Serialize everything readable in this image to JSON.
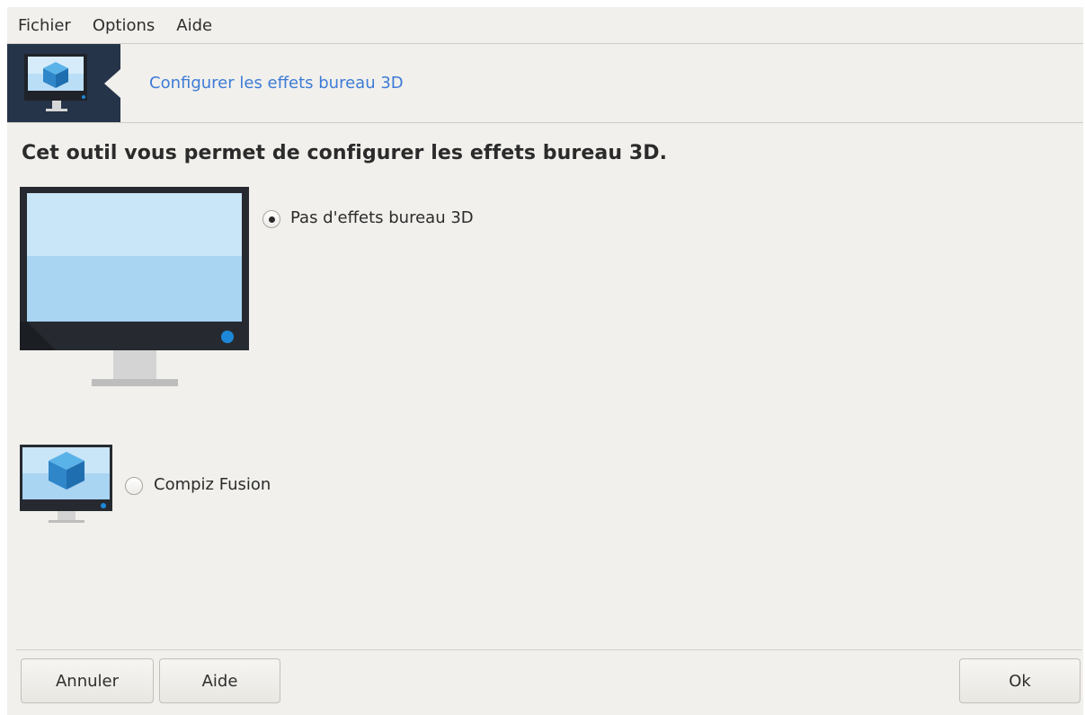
{
  "menubar": {
    "items": [
      "Fichier",
      "Options",
      "Aide"
    ]
  },
  "header": {
    "title": "Configurer les effets bureau 3D",
    "icon": "monitor-cube-icon"
  },
  "intro": "Cet outil vous permet de configurer les effets bureau 3D.",
  "options": [
    {
      "label": "Pas d'effets bureau 3D",
      "selected": true,
      "icon": "monitor-icon"
    },
    {
      "label": "Compiz Fusion",
      "selected": false,
      "icon": "monitor-cube-icon"
    }
  ],
  "buttons": {
    "cancel": "Annuler",
    "help": "Aide",
    "ok": "Ok"
  },
  "colors": {
    "window_bg": "#f1f0ec",
    "header_icon_bg": "#263449",
    "link": "#3d7bd6",
    "accent_dot": "#1e88d8"
  }
}
